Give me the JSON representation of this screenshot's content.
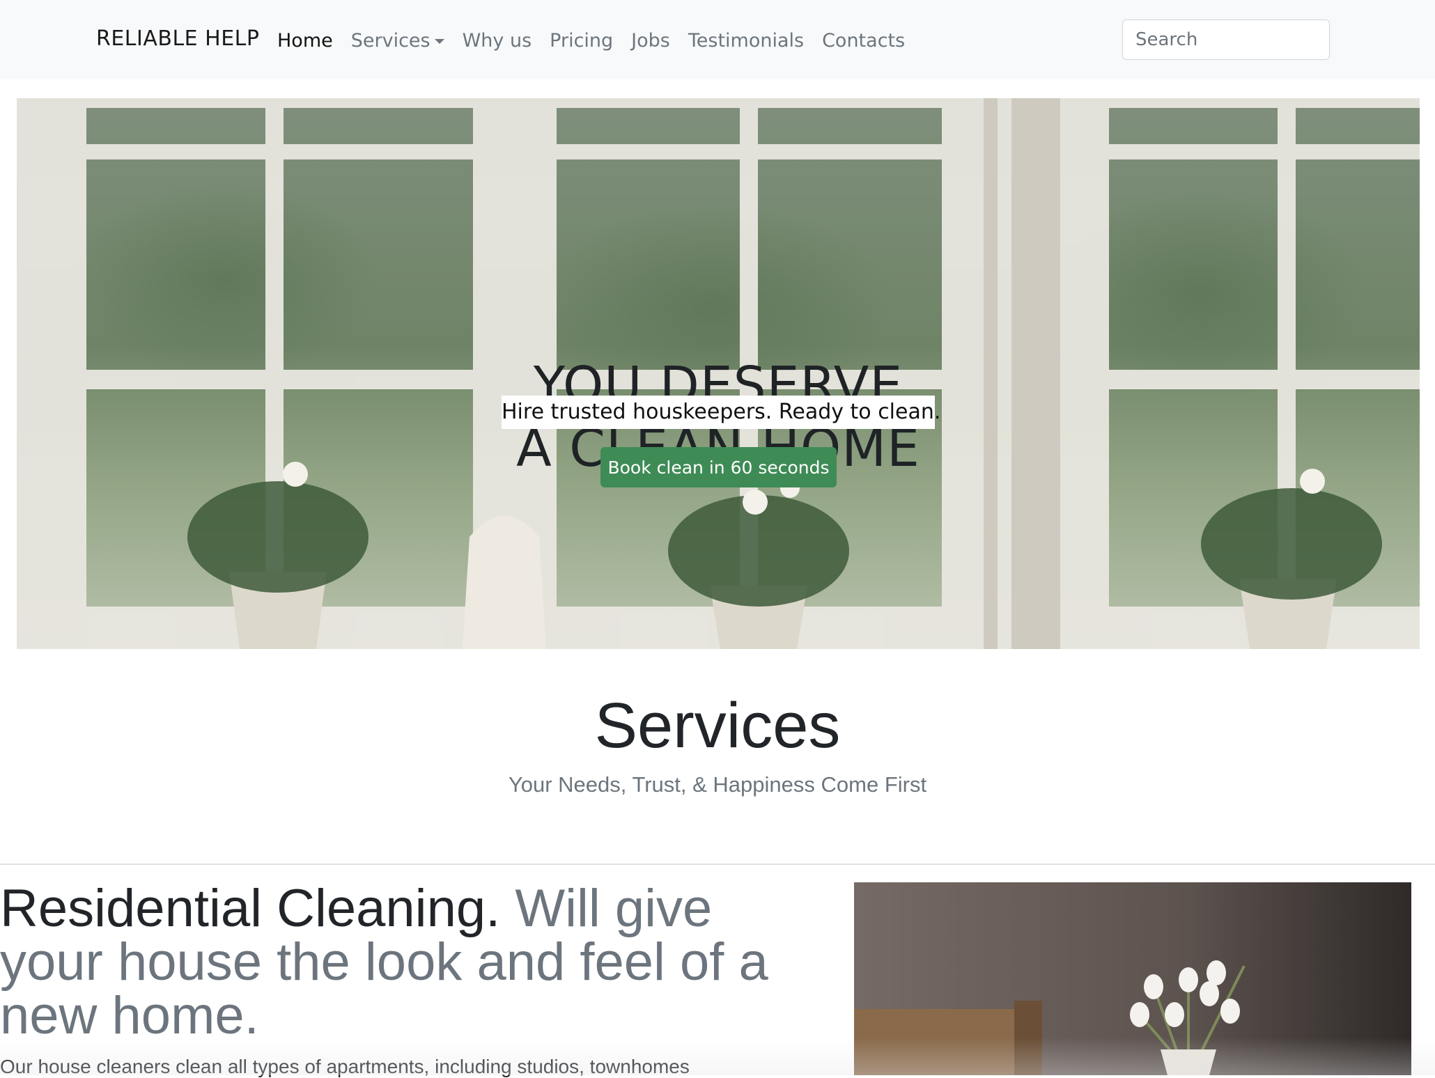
{
  "navbar": {
    "brand": "RELIABLE HELP",
    "links": [
      {
        "label": "Home",
        "active": true
      },
      {
        "label": "Services",
        "dropdown": true
      },
      {
        "label": "Why us"
      },
      {
        "label": "Pricing"
      },
      {
        "label": "Jobs"
      },
      {
        "label": "Testimonials"
      },
      {
        "label": "Contacts"
      }
    ],
    "search_placeholder": "Search"
  },
  "hero": {
    "title_line1": "YOU DESERVE",
    "title_line2": "A CLEAN HOME",
    "subtitle": "Hire trusted houskeepers. Ready to clean.",
    "cta_label": "Book clean in 60 seconds",
    "image": "window-with-flower-vases-photo"
  },
  "services": {
    "title": "Services",
    "subtitle": "Your Needs, Trust, & Happiness Come First"
  },
  "feature": {
    "heading_strong": "Residential Cleaning.",
    "heading_muted": "Will give your house the look and feel of a new home.",
    "text": "Our house cleaners clean all types of apartments, including studios, townhomes",
    "image": "white-tulips-vase-photo"
  },
  "colors": {
    "navbar_bg": "#f8f9fa",
    "cta_green": "#3f8b56",
    "muted_text": "#6c757d"
  }
}
